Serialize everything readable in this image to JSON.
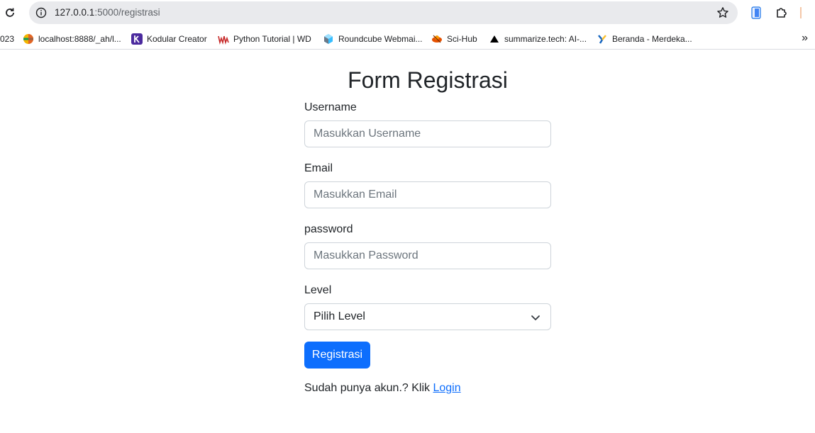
{
  "browser": {
    "url_host": "127.0.0.1",
    "url_path": ":5000/registrasi",
    "bookmarks": [
      {
        "label": "023",
        "icon": "none"
      },
      {
        "label": "localhost:8888/_ah/l...",
        "icon": "globe-color-icon"
      },
      {
        "label": "Kodular Creator",
        "icon": "kodular-icon"
      },
      {
        "label": "Python Tutorial | WD",
        "icon": "wd-icon"
      },
      {
        "label": "Roundcube Webmai...",
        "icon": "roundcube-icon"
      },
      {
        "label": "Sci-Hub",
        "icon": "scihub-icon"
      },
      {
        "label": "summarize.tech: AI-...",
        "icon": "triangle-icon"
      },
      {
        "label": "Beranda - Merdeka...",
        "icon": "merdeka-icon"
      }
    ],
    "overflow": "»"
  },
  "form": {
    "title": "Form Registrasi",
    "username_label": "Username",
    "username_placeholder": "Masukkan Username",
    "email_label": "Email",
    "email_placeholder": "Masukkan Email",
    "password_label": "password",
    "password_placeholder": "Masukkan Password",
    "level_label": "Level",
    "level_selected": "Pilih Level",
    "submit_label": "Registrasi",
    "footer_text": "Sudah punya akun.? Klik ",
    "login_link": "Login"
  },
  "colors": {
    "primary": "#0d6efd",
    "text": "#212529",
    "placeholder": "#6c757d",
    "border": "#ced4da"
  }
}
